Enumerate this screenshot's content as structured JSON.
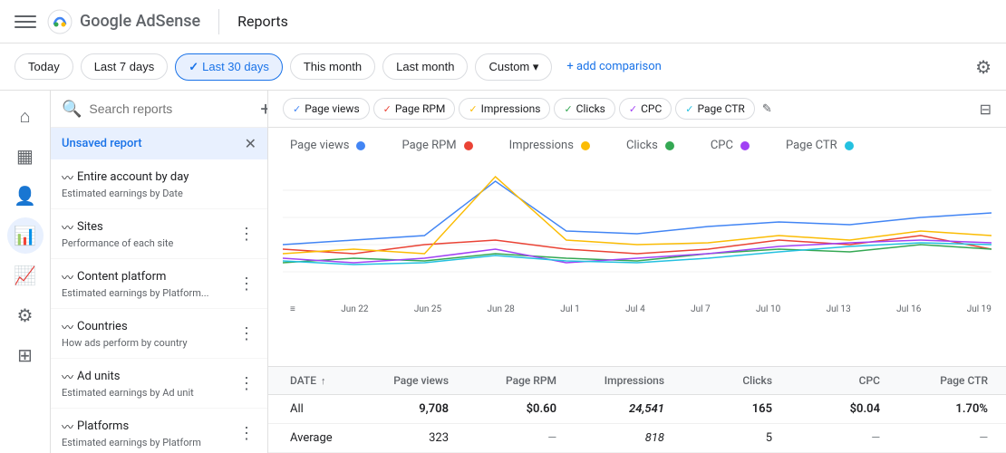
{
  "nav": {
    "title": "Reports",
    "logo_text": "Google AdSense"
  },
  "date_filters": {
    "today": "Today",
    "last7": "Last 7 days",
    "last30": "Last 30 days",
    "this_month": "This month",
    "last_month": "Last month",
    "custom": "Custom",
    "add_comparison": "+ add comparison",
    "active": "last30"
  },
  "metric_tabs": [
    {
      "label": "Page views",
      "color": "#4285f4",
      "active": true
    },
    {
      "label": "Page RPM",
      "color": "#ea4335",
      "active": true
    },
    {
      "label": "Impressions",
      "color": "#fbbc04",
      "active": true
    },
    {
      "label": "Clicks",
      "color": "#34a853",
      "active": true
    },
    {
      "label": "CPC",
      "color": "#a142f4",
      "active": true
    },
    {
      "label": "Page CTR",
      "color": "#24c1e0",
      "active": true
    }
  ],
  "chart_legend": [
    {
      "label": "Page views",
      "color": "#4285f4"
    },
    {
      "label": "Page RPM",
      "color": "#ea4335"
    },
    {
      "label": "Impressions",
      "color": "#fbbc04"
    },
    {
      "label": "Clicks",
      "color": "#34a853"
    },
    {
      "label": "CPC",
      "color": "#a142f4"
    },
    {
      "label": "Page CTR",
      "color": "#24c1e0"
    }
  ],
  "x_axis_labels": [
    "Jun 22",
    "Jun 25",
    "Jun 28",
    "Jul 1",
    "Jul 4",
    "Jul 7",
    "Jul 10",
    "Jul 13",
    "Jul 16",
    "Jul 19"
  ],
  "table": {
    "headers": {
      "date": "DATE",
      "pageviews": "Page views",
      "pagerpm": "Page RPM",
      "impressions": "Impressions",
      "clicks": "Clicks",
      "cpc": "CPC",
      "pagectr": "Page CTR"
    },
    "rows": [
      {
        "date": "All",
        "pageviews": "9,708",
        "pagerpm": "$0.60",
        "impressions": "24,541",
        "clicks": "165",
        "cpc": "$0.04",
        "pagectr": "1.70%"
      },
      {
        "date": "Average",
        "pageviews": "323",
        "pagerpm": "—",
        "impressions": "818",
        "clicks": "5",
        "cpc": "—",
        "pagectr": "—"
      }
    ]
  },
  "sidebar": {
    "search_placeholder": "Search reports",
    "active_report": "Unsaved report",
    "items": [
      {
        "title": "Entire account by day",
        "subtitle": "Estimated earnings by Date"
      },
      {
        "title": "Sites",
        "subtitle": "Performance of each site"
      },
      {
        "title": "Content platform",
        "subtitle": "Estimated earnings by Platform..."
      },
      {
        "title": "Countries",
        "subtitle": "How ads perform by country"
      },
      {
        "title": "Ad units",
        "subtitle": "Estimated earnings by Ad unit"
      },
      {
        "title": "Platforms",
        "subtitle": "Estimated earnings by Platform"
      }
    ]
  },
  "left_nav": {
    "icons": [
      "home",
      "chart",
      "people",
      "bar_chart",
      "trending_up",
      "settings",
      "extension"
    ]
  }
}
